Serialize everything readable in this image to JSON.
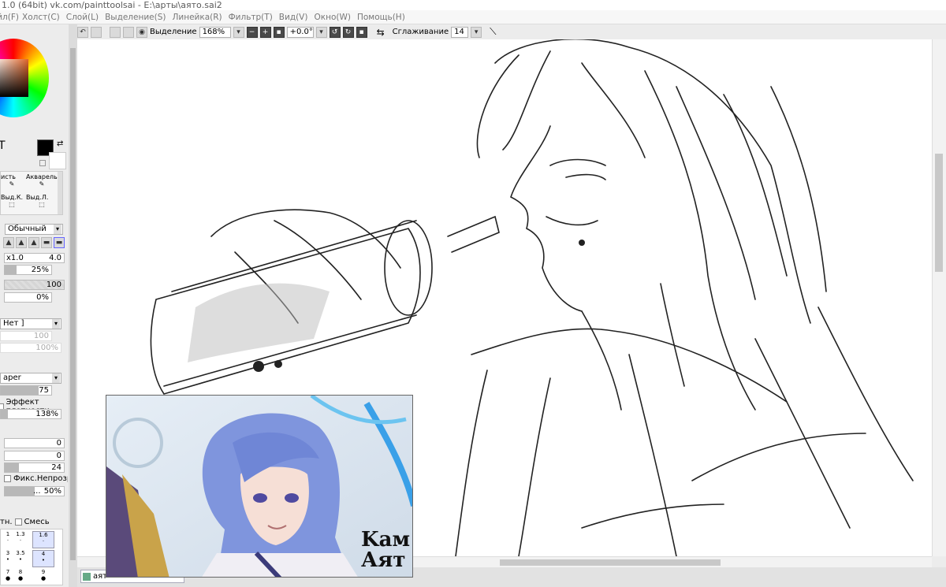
{
  "window": {
    "title": "1.0 (64bit) vk.com/painttoolsai - E:\\арты\\аято.sai2"
  },
  "menu": [
    "Холст(C)",
    "Слой(L)",
    "Выделение(S)",
    "Линейка(R)",
    "Фильтр(T)",
    "Вид(V)",
    "Окно(W)",
    "Помощь(H)"
  ],
  "menu_partial": "Файл(F)",
  "toolbar": {
    "selection_label": "Выделение",
    "zoom": "168%",
    "rotation": "+0.0°",
    "smoothing_label": "Сглаживание",
    "smoothing_value": "14"
  },
  "left_panel": {
    "tool_text_partial": "T",
    "brush_names": [
      "исть",
      "Акварель",
      "Выд.К.",
      "Выд.Л."
    ],
    "blend_mode": "Обычный",
    "size_multiplier": "x1.0",
    "size_value": "4.0",
    "min_size": "25%",
    "density": "100",
    "blend_pct": "0%",
    "texture_select": "Нет ]",
    "texture_val1": "100",
    "texture_val2": "100%",
    "paper_select": "aper",
    "paper_strength": "75",
    "density_effect_label": "Эффект плотности",
    "density_effect_value": "138%",
    "param1": "0",
    "param2": "0",
    "param3": "24",
    "keep_opacity_label": "Фикс.Непрозр.",
    "param4_prefix": "...",
    "param4": "50%",
    "mix_partial": "тн.",
    "mix_label": "Смесь",
    "brush_sizes": [
      "1",
      "1.3",
      "1.6",
      "3",
      "3.5",
      "4",
      "7",
      "8",
      "9"
    ]
  },
  "tab": {
    "label": "аят"
  },
  "reference": {
    "caption_line1": "Kам",
    "caption_line2": "Аят"
  },
  "colors": {
    "primary": "#000000",
    "accent": "#4a4a4a",
    "panel": "#ececec"
  },
  "icons": [
    "undo-icon",
    "eye-icon",
    "minus-icon",
    "plus-icon",
    "rotate-icon",
    "swap-icon",
    "line-icon",
    "color-wheel-icon",
    "swap-color-icon"
  ]
}
